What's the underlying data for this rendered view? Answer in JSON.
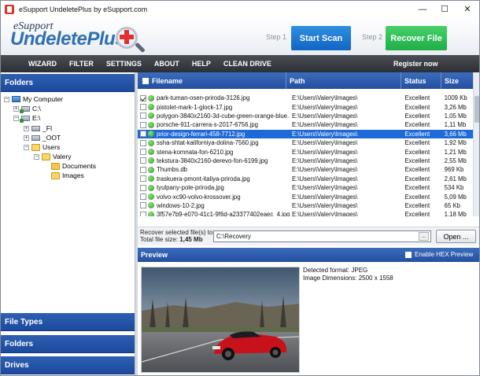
{
  "window": {
    "title": "eSupport UndeletePlus by eSupport.com",
    "minimize_glyph": "—",
    "maximize_glyph": "☐",
    "close_glyph": "✕"
  },
  "logo": {
    "small": "eSupport",
    "big_main": "Undelete",
    "big_plus": "Plus"
  },
  "steps": {
    "step1": "Step 1",
    "scan": "Start Scan",
    "step2": "Step 2",
    "recover": "Recover File"
  },
  "menu": {
    "wizard": "WIZARD",
    "filter": "FILTER",
    "settings": "SETTINGS",
    "about": "ABOUT",
    "help": "HELP",
    "clean_drive": "CLEAN DRIVE",
    "register": "Register now"
  },
  "left": {
    "folders_header": "Folders",
    "tree": [
      {
        "label": "My Computer",
        "expander": "−"
      },
      {
        "label": "C:\\",
        "expander": "+"
      },
      {
        "label": "E:\\",
        "expander": "−"
      },
      {
        "label": "_FI",
        "expander": "+"
      },
      {
        "label": "_OOT",
        "expander": "+"
      },
      {
        "label": "Users",
        "expander": "−"
      },
      {
        "label": "Valery",
        "expander": "−"
      },
      {
        "label": "Documents",
        "expander": ""
      },
      {
        "label": "Images",
        "expander": ""
      }
    ],
    "file_types": "File Types",
    "folders": "Folders",
    "drives": "Drives"
  },
  "filelist": {
    "headers": {
      "name": "Filename",
      "path": "Path",
      "status": "Status",
      "size": "Size"
    },
    "rows": [
      {
        "name": "park-tuman-osen-priroda-3126.jpg",
        "path": "E:\\Users\\Valery\\Images\\",
        "status": "Excellent",
        "size": "1009 Kb",
        "checked": true,
        "selected": false
      },
      {
        "name": "pistolet-mark-1-glock-17.jpg",
        "path": "E:\\Users\\Valery\\Images\\",
        "status": "Excellent",
        "size": "3,26 Mb",
        "checked": false,
        "selected": false
      },
      {
        "name": "polygon-3840x2160-3d-cube-green-orange-blue...",
        "path": "E:\\Users\\Valery\\Images\\",
        "status": "Excellent",
        "size": "1,05 Mb",
        "checked": false,
        "selected": false
      },
      {
        "name": "porsche-911-carrera-s-2017-6756.jpg",
        "path": "E:\\Users\\Valery\\Images\\",
        "status": "Excellent",
        "size": "1,11 Mb",
        "checked": false,
        "selected": false
      },
      {
        "name": "prior-design-ferrari-458-7712.jpg",
        "path": "E:\\Users\\Valery\\Images\\",
        "status": "Excellent",
        "size": "3,66 Mb",
        "checked": false,
        "selected": true
      },
      {
        "name": "ssha-shtat-kaliforniya-dolina-7560.jpg",
        "path": "E:\\Users\\Valery\\Images\\",
        "status": "Excellent",
        "size": "1,92 Mb",
        "checked": false,
        "selected": false
      },
      {
        "name": "stena-komnata-fon-6210.jpg",
        "path": "E:\\Users\\Valery\\Images\\",
        "status": "Excellent",
        "size": "1,21 Mb",
        "checked": false,
        "selected": false
      },
      {
        "name": "tekstura-3840x2160-derevo-fon-6199.jpg",
        "path": "E:\\Users\\Valery\\Images\\",
        "status": "Excellent",
        "size": "2,55 Mb",
        "checked": false,
        "selected": false
      },
      {
        "name": "Thumbs.db",
        "path": "E:\\Users\\Valery\\Images\\",
        "status": "Excellent",
        "size": "969 Kb",
        "checked": false,
        "selected": false
      },
      {
        "name": "traskuera-pmont-italiya-priroda.jpg",
        "path": "E:\\Users\\Valery\\Images\\",
        "status": "Excellent",
        "size": "2,61 Mb",
        "checked": false,
        "selected": false
      },
      {
        "name": "tyulpany-pole-priroda.jpg",
        "path": "E:\\Users\\Valery\\Images\\",
        "status": "Excellent",
        "size": "534 Kb",
        "checked": false,
        "selected": false
      },
      {
        "name": "volvo-xc90-volvo-krossover.jpg",
        "path": "E:\\Users\\Valery\\Images\\",
        "status": "Excellent",
        "size": "5,09 Mb",
        "checked": false,
        "selected": false
      },
      {
        "name": "windows-10-2.jpg",
        "path": "E:\\Users\\Valery\\Images\\",
        "status": "Excellent",
        "size": "65 Kb",
        "checked": false,
        "selected": false
      },
      {
        "name": "3f57e7b9-e070-41c1-9f6d-a23377402eaec_4.jpg",
        "path": "E:\\Users\\Valery\\Images\\",
        "status": "Excellent",
        "size": "1,18 Mb",
        "checked": false,
        "selected": false
      }
    ]
  },
  "recover": {
    "label": "Recover selected file(s) to:",
    "total_label": "Total file size:",
    "total_value": "1,45 Mb",
    "path_value": "C:\\Recovery",
    "browse": "...",
    "open": "Open ..."
  },
  "preview": {
    "header": "Preview",
    "hex_label": "Enable HEX Preview",
    "format_line": "Detected format: JPEG",
    "dimensions_line": "Image Dimensions: 2500 x 1558"
  }
}
